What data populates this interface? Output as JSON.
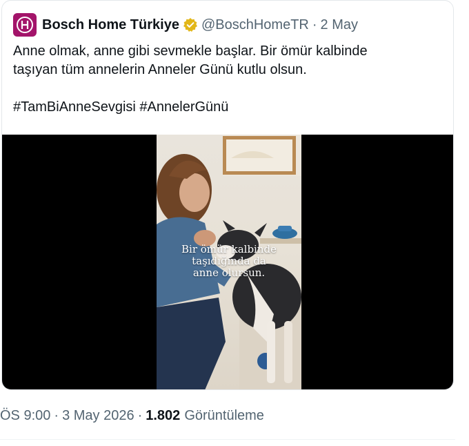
{
  "tweet": {
    "author_name": "Bosch Home Türkiye",
    "handle": "@BoschHomeTR",
    "separator": "·",
    "date": "2 May",
    "text_line1": "Anne olmak, anne gibi sevmekle başlar. Bir ömür kalbinde",
    "text_line2": "taşıyan tüm annelerin Anneler Günü kutlu olsun.",
    "hashtags": "#TamBiAnneSevgisi #AnnelerGünü",
    "video_caption_line1": "Bir ömür kalbinde",
    "video_caption_line2": "taşıdığında da",
    "video_caption_line3": "anne olursun.",
    "time": "ÖS 9:00",
    "full_date": "3 May 2026",
    "views_count": "1.802",
    "views_label": "Görüntüleme"
  },
  "colors": {
    "brand": "#a3146a",
    "verified": "#e2b719",
    "muted_text": "#536471",
    "text": "#0f1419"
  },
  "icons": {
    "avatar": "bosch-logo-icon",
    "verified": "verified-badge-icon"
  }
}
